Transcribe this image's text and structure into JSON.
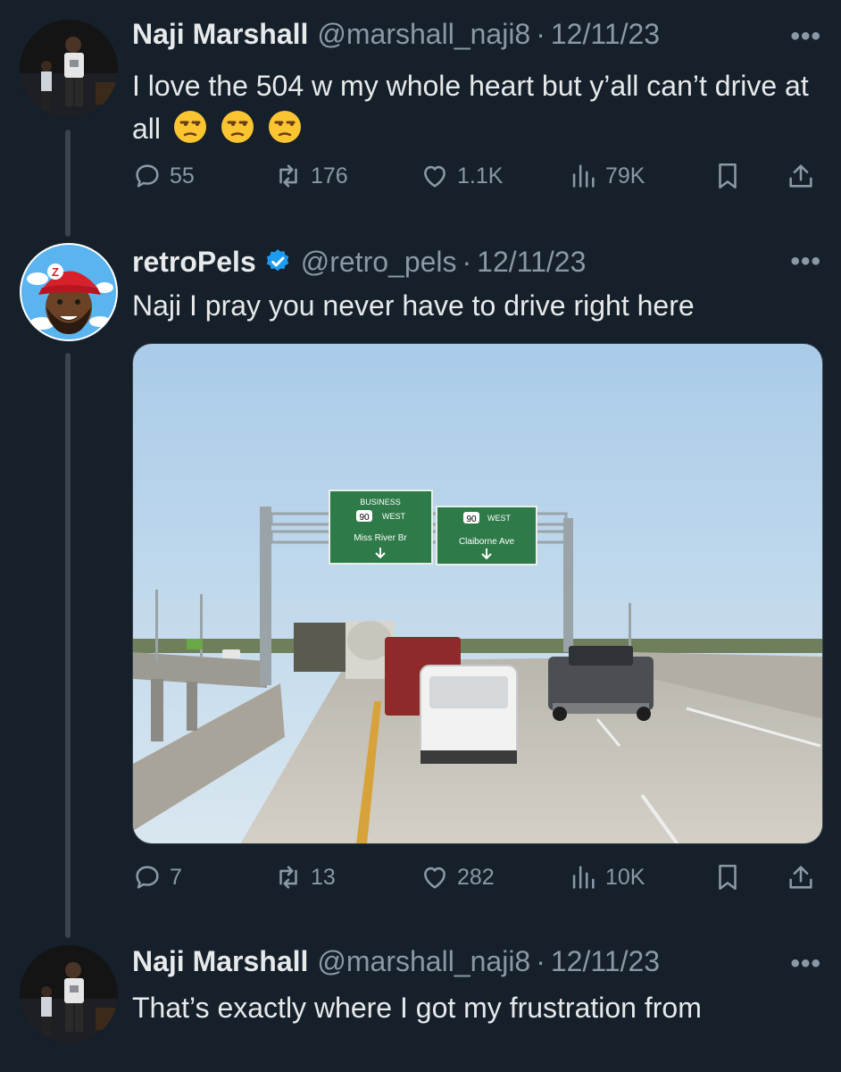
{
  "tweets": [
    {
      "name": "Naji Marshall",
      "handle": "@marshall_naji8",
      "date": "12/11/23",
      "text": "I love the 504 w my whole heart but y’all can’t drive at all",
      "emojis": [
        "unamused-face",
        "unamused-face",
        "unamused-face"
      ],
      "stats": {
        "replies": "55",
        "retweets": "176",
        "likes": "1.1K",
        "views": "79K"
      }
    },
    {
      "name": "retroPels",
      "handle": "@retro_pels",
      "date": "12/11/23",
      "verified": true,
      "text": "Naji I pray you never have to drive right here",
      "stats": {
        "replies": "7",
        "retweets": "13",
        "likes": "282",
        "views": "10K"
      },
      "image": {
        "signs": [
          {
            "line1": "BUSINESS",
            "route": "90",
            "direction": "WEST",
            "destination": "Miss River Br"
          },
          {
            "route": "90",
            "direction": "WEST",
            "destination": "Claiborne Ave"
          }
        ]
      }
    },
    {
      "name": "Naji Marshall",
      "handle": "@marshall_naji8",
      "date": "12/11/23",
      "text": "That’s exactly where I got my frustration from"
    }
  ],
  "more_label": "•••",
  "separator": "·",
  "colors": {
    "background": "#15202b",
    "muted": "#8b98a5",
    "verified": "#1d9bf0"
  }
}
